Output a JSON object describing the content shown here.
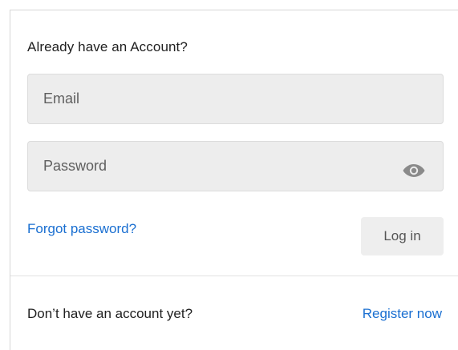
{
  "login_form": {
    "heading": "Already have an Account?",
    "email": {
      "value": "",
      "placeholder": "Email"
    },
    "password": {
      "value": "",
      "placeholder": "Password",
      "toggle_icon": "eye-icon"
    },
    "forgot_password_label": "Forgot password?",
    "login_button_label": "Log in"
  },
  "signup_prompt": {
    "text": "Don’t have an account yet?",
    "register_label": "Register now"
  },
  "colors": {
    "link": "#1a6fd1",
    "field_background": "#ededed",
    "button_background": "#eeeeee",
    "text": "#212121"
  }
}
